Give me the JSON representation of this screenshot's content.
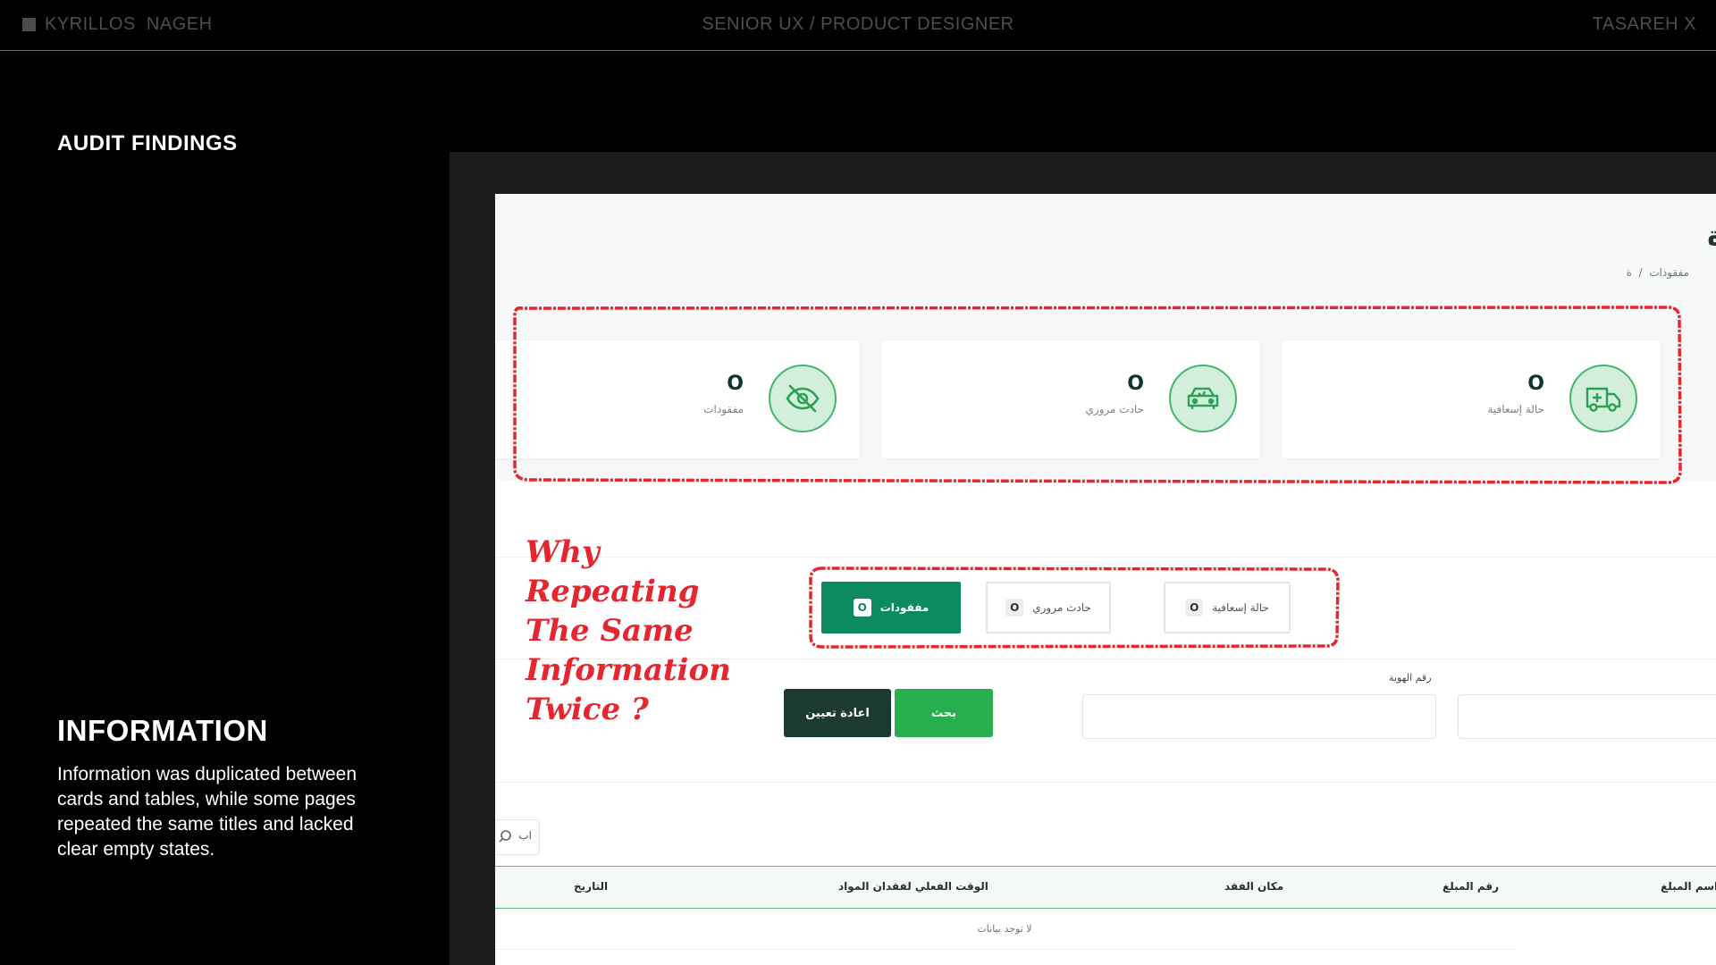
{
  "topbar": {
    "left": "KYRILLOS  NAGEH",
    "center": "SENIOR UX / PRODUCT DESIGNER",
    "right": "TASAREH X"
  },
  "section_title": "AUDIT FINDINGS",
  "info": {
    "title": "INFORMATION",
    "body": "Information was duplicated between cards and tables, while some pages repeated the same titles and lacked clear empty states."
  },
  "annotation": "Why Repeating The Same Information Twice ?",
  "screenshot": {
    "page_title": "ة",
    "breadcrumb": "مفقودات  /  ة",
    "stat_cards": [
      {
        "label": "حالة إسعافية",
        "value": "O",
        "icon": "ambulance-icon"
      },
      {
        "label": "حادث مروري",
        "value": "O",
        "icon": "car-crash-icon"
      },
      {
        "label": "مفقودات",
        "value": "O",
        "icon": "eye-off-icon"
      }
    ],
    "chips": [
      {
        "label": "حالة إسعافية",
        "count": "O"
      },
      {
        "label": "حادث مروري",
        "count": "O"
      },
      {
        "label": "مفقودات",
        "count": "O"
      }
    ],
    "field_label": "رقم الهوية",
    "search_button": "بحث",
    "reset_button": "اعادة تعيين",
    "search_stub": "اب",
    "table_headers": [
      "اسم المبلغ",
      "رقم المبلغ",
      "مكان الفقد",
      "الوقت الفعلي لفقدان المواد",
      "التاريخ"
    ],
    "empty_state": "لا توجد بيانات",
    "accent_color": "#0b8a62",
    "annotation_color": "#e5262e"
  }
}
